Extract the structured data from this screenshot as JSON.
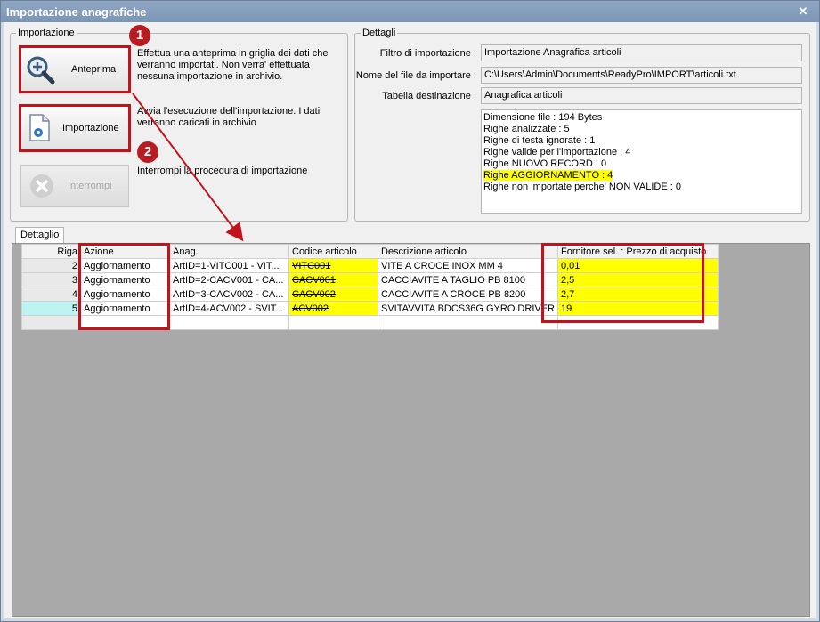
{
  "window": {
    "title": "Importazione anagrafiche",
    "close_glyph": "✕"
  },
  "import_group": {
    "label": "Importazione",
    "preview_button": "Anteprima",
    "preview_desc": "Effettua una anteprima in griglia dei dati che verranno importati. Non verra' effettuata nessuna importazione in archivio.",
    "import_button": "Importazione",
    "import_desc": "Avvia l'esecuzione dell'importazione. I dati verranno caricati in archivio",
    "stop_button": "Interrompi",
    "stop_desc": "Interrompi la procedura di importazione"
  },
  "callouts": [
    "1",
    "2"
  ],
  "details_group": {
    "label": "Dettagli",
    "filter_label": "Filtro di importazione :",
    "filter_value": "Importazione Anagrafica articoli",
    "file_label": "Nome del file da importare :",
    "file_value": "C:\\Users\\Admin\\Documents\\ReadyPro\\IMPORT\\articoli.txt",
    "table_label": "Tabella destinazione :",
    "table_value": "Anagrafica articoli",
    "stats": [
      "Dimensione file : 194 Bytes",
      "Righe analizzate : 5",
      "Righe di testa ignorate : 1",
      "Righe valide per l'importazione : 4",
      "Righe NUOVO RECORD : 0",
      "Righe AGGIORNAMENTO  : 4",
      "Righe non importate perche' NON VALIDE : 0"
    ]
  },
  "tab_label": "Dettaglio",
  "grid": {
    "headers": [
      "Riga",
      "Azione",
      "Anag.",
      "Codice articolo",
      "Descrizione articolo",
      "Fornitore sel. : Prezzo di acquisto"
    ],
    "rows": [
      {
        "n": "2",
        "azione": "Aggiornamento",
        "anag": "ArtID=1-VITC001 - VIT...",
        "codice": "VITC001",
        "desc": "VITE A CROCE INOX MM 4",
        "prezzo": "0,01"
      },
      {
        "n": "3",
        "azione": "Aggiornamento",
        "anag": "ArtID=2-CACV001 - CA...",
        "codice": "CACV001",
        "desc": "CACCIAVITE A TAGLIO PB 8100",
        "prezzo": "2,5"
      },
      {
        "n": "4",
        "azione": "Aggiornamento",
        "anag": "ArtID=3-CACV002 - CA...",
        "codice": "CACV002",
        "desc": "CACCIAVITE A CROCE PB 8200",
        "prezzo": "2,7"
      },
      {
        "n": "5",
        "azione": "Aggiornamento",
        "anag": "ArtID=4-ACV002 - SVIT...",
        "codice": "ACV002",
        "desc": "SVITAVVITA BDCS36G GYRO DRIVER",
        "prezzo": "19"
      }
    ]
  },
  "colors": {
    "highlight": "#ffff00",
    "annotation_red": "#c0131b",
    "title_bar": "#7b95b5"
  }
}
